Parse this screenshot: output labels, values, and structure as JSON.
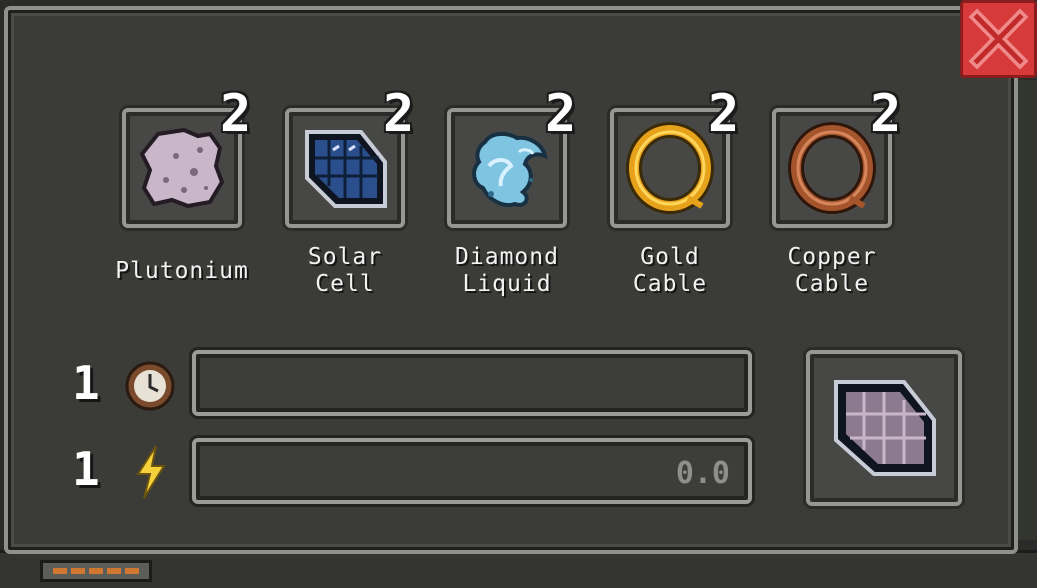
{
  "ingredients": [
    {
      "name": "Plutonium",
      "count": "2",
      "icon": "plutonium-icon"
    },
    {
      "name": "Solar\nCell",
      "count": "2",
      "icon": "solar-cell-icon"
    },
    {
      "name": "Diamond\nLiquid",
      "count": "2",
      "icon": "diamond-liquid-icon"
    },
    {
      "name": "Gold\nCable",
      "count": "2",
      "icon": "gold-cable-icon"
    },
    {
      "name": "Copper\nCable",
      "count": "2",
      "icon": "copper-cable-icon"
    }
  ],
  "requirements": {
    "time": {
      "amount": "1",
      "icon": "clock-icon",
      "progress": 0
    },
    "energy": {
      "amount": "1",
      "icon": "lightning-icon",
      "value": "0.0"
    }
  },
  "output": {
    "icon": "plutonium-cell-icon"
  },
  "colors": {
    "close": "#d63a3a",
    "frame": "#959892",
    "panel": "#3b3b38"
  }
}
